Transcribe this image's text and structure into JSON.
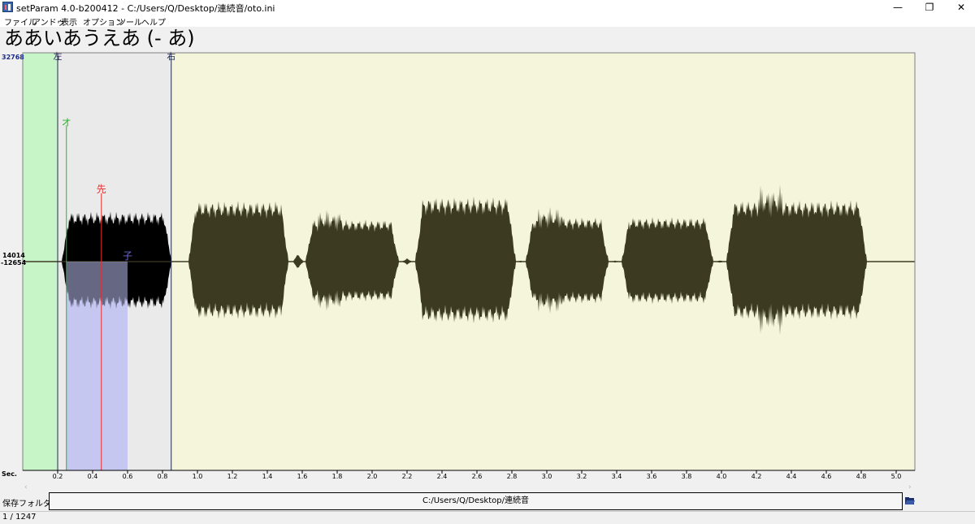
{
  "window": {
    "title": "setParam 4.0-b200412 -  C:/Users/Q/Desktop/連続音/oto.ini",
    "minimize_glyph": "—",
    "maximize_glyph": "❐",
    "close_glyph": "✕"
  },
  "menu": [
    "ファイル",
    "アンドゥ",
    "表示",
    "オプション",
    "ツール",
    "ヘルプ"
  ],
  "alias_title": "ああいあうえあ (- あ)",
  "waveform": {
    "amp_top_label": "32768",
    "amp_max_label": "14014",
    "amp_min_label": "-12654",
    "axis_unit_label": "Sec.",
    "x_ticks": [
      "0.2",
      "0.4",
      "0.6",
      "0.8",
      "1.0",
      "1.2",
      "1.4",
      "1.6",
      "1.8",
      "2.0",
      "2.2",
      "2.4",
      "2.6",
      "2.8",
      "3.0",
      "3.2",
      "3.4",
      "3.6",
      "3.8",
      "4.0",
      "4.2",
      "4.4",
      "4.6",
      "4.8",
      "5.0"
    ],
    "markers": {
      "offset_label": "左",
      "cutoff_label": "右",
      "overlap_label": "オ",
      "preutterance_label": "先",
      "consonant_label": "子"
    },
    "params_seconds": {
      "offset": 0.2,
      "overlap": 0.25,
      "preutterance": 0.45,
      "consonant_end": 0.6,
      "cutoff": 0.85
    },
    "colors": {
      "background": "#f5f5dc",
      "offset_region": "#c8f5c8",
      "selected_region": "#eaeaea",
      "consonant_region": "#cfd2f2",
      "wave_dark": "#000000",
      "wave_main": "#3c3b22",
      "overlap_line": "#27b327",
      "preutterance_line": "#e42e2e",
      "consonant_label": "#6a6ad8",
      "boundary_line": "#1f2a4a"
    }
  },
  "footer": {
    "save_folder_label": "保存フォルダ：",
    "save_folder_path": "C:/Users/Q/Desktop/連続音",
    "folder_icon": "folder-open-icon",
    "status_count": "1 / 1247"
  }
}
